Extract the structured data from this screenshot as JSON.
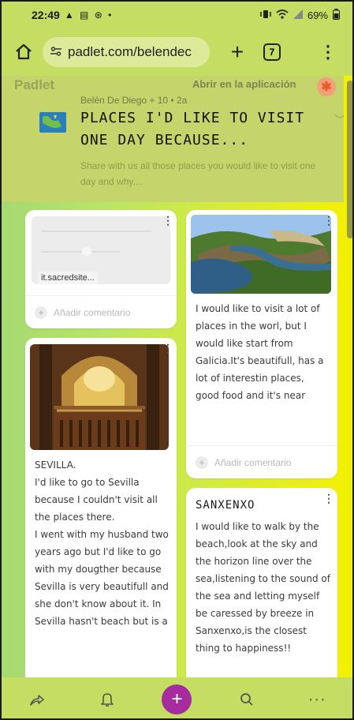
{
  "status_bar": {
    "time": "22:49",
    "status_glyphs": "▲ ▤ ⊛ •",
    "battery": "69%"
  },
  "browser": {
    "url": "padlet.com/belendec",
    "tab_count": "7"
  },
  "header": {
    "logo": "Padlet",
    "open_in_app": "Abrir en la aplicación",
    "author_line": "Belén De Diego + 10 • 2a",
    "title": "PLACES I'D LIKE TO VISIT ONE DAY BECAUSE...",
    "description": "Share with  us all those places you would like to visit one day and why...."
  },
  "posts": [
    {
      "link_label": "it.sacredsite...",
      "comment_placeholder": "Añadir comentario"
    },
    {
      "body": "I would like to visit a lot of places in the worl, but I would like start from  Galicia.It's beautifull, has a lot of interestin places, good food and it's near",
      "comment_placeholder": "Añadir comentario"
    },
    {
      "body": "SEVILLA.\nI'd like to go to Sevilla because I couldn't visit all the places there.\nI went with my husband two years ago but I'd like to go with my dougther because Sevilla is very beautifull and she don't know about it. In Sevilla hasn't beach but is a"
    },
    {
      "title": "SANXENXO",
      "body": "I would like to walk by the beach,look at the sky and the horizon line over the sea,listening to the sound of the sea and letting myself be caressed by breeze in Sanxenxo,is the closest thing to happiness!!"
    }
  ],
  "colors": {
    "app_bar": "#c5dd62",
    "wall_start": "#a5da72",
    "wall_end": "#f3f007",
    "fab": "#a62b9e"
  }
}
